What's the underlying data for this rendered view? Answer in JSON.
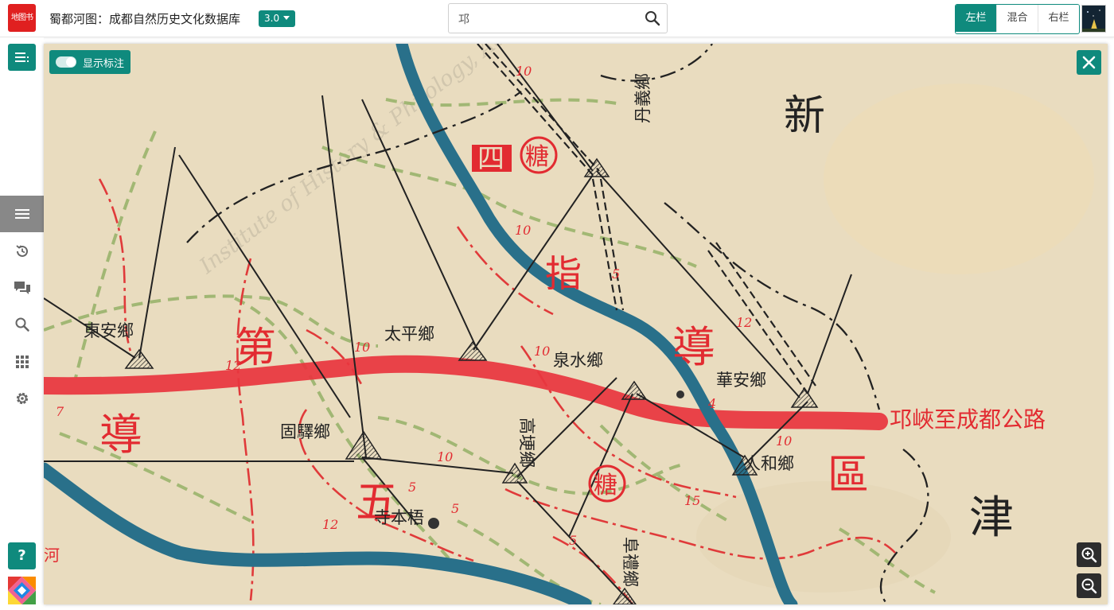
{
  "header": {
    "logo_text": "地图书",
    "app_title": "蜀都河图：成都自然历史文化数据库",
    "version": "3.0",
    "search": {
      "value": "邛"
    },
    "layout_buttons": [
      "左栏",
      "混合",
      "右栏"
    ],
    "layout_active": "左栏",
    "accent_color": "#0f8a7d"
  },
  "sidebar": {
    "items": [
      {
        "icon": "menu-icon",
        "active": true
      },
      {
        "icon": "history-icon"
      },
      {
        "icon": "comments-icon"
      },
      {
        "icon": "search-icon"
      },
      {
        "icon": "grid-icon"
      },
      {
        "icon": "settings-icon"
      }
    ],
    "help_label": "?"
  },
  "map": {
    "toggle_label": "显示标注",
    "labels": {
      "xin": "新",
      "jin": "津",
      "zhi": "指",
      "dao_center": "導",
      "dao_left": "導",
      "di": "第",
      "si": "四",
      "wu": "五",
      "qu": "區",
      "road": "邛峽至成都公路",
      "he": "河",
      "town_dongan": "東安鄉",
      "town_taiping": "太平鄉",
      "town_quanshui": "泉水鄉",
      "town_huayi": "華安鄉",
      "town_danyi": "丹義鄉",
      "town_guyi": "固驛鄉",
      "town_gaogeng": "高埂鄉",
      "town_renhe": "人和鄉",
      "town_fuli": "阜禮鄉",
      "temple": "寺本梧",
      "seal": "糖",
      "watermark": "Institute of History & Philology, Academia"
    },
    "numbers": [
      "10",
      "10",
      "10",
      "10",
      "12",
      "12",
      "12",
      "10",
      "10",
      "15",
      "5",
      "5",
      "5",
      "7",
      "5",
      "4"
    ]
  }
}
